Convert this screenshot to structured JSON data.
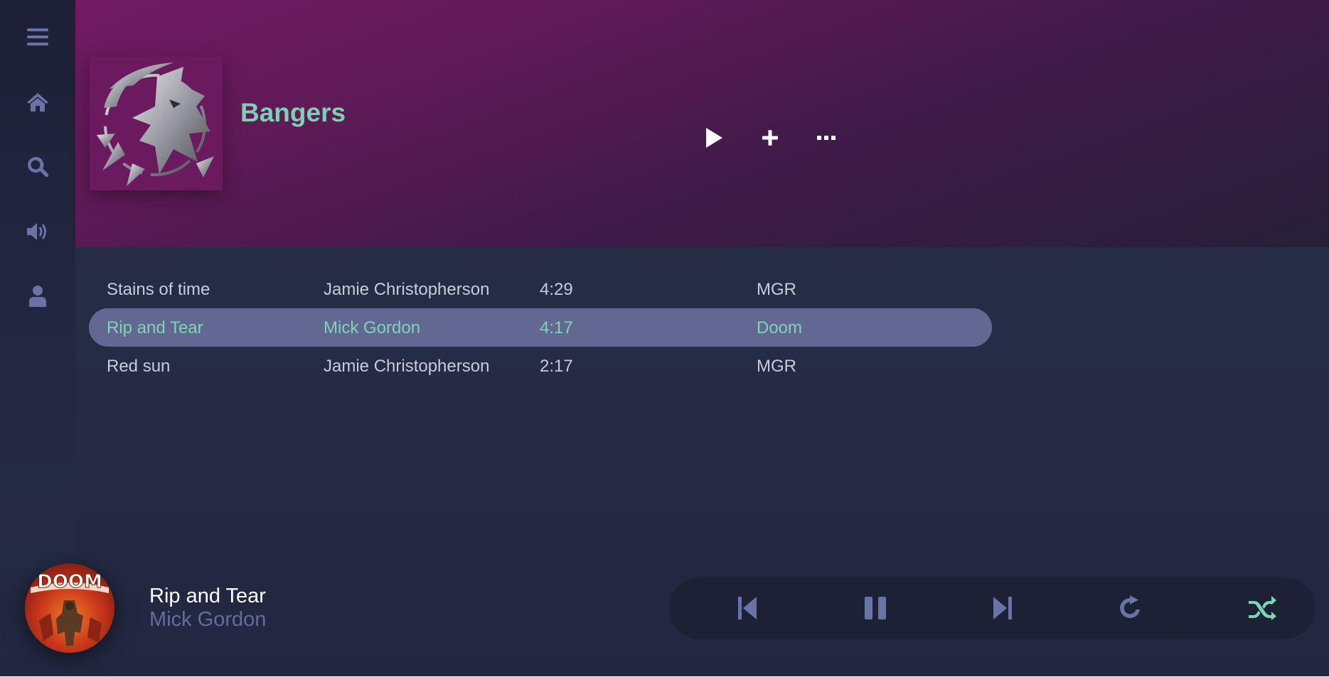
{
  "sidebar": {
    "items": [
      {
        "name": "menu",
        "icon": "hamburger-icon"
      },
      {
        "name": "home",
        "icon": "home-icon"
      },
      {
        "name": "search",
        "icon": "search-icon"
      },
      {
        "name": "volume",
        "icon": "volume-icon"
      },
      {
        "name": "profile",
        "icon": "user-icon"
      }
    ]
  },
  "header": {
    "title": "Bangers",
    "cover_icon": "wolf-medallion-art",
    "actions": [
      {
        "name": "play",
        "icon": "play-icon"
      },
      {
        "name": "add",
        "icon": "plus-icon"
      },
      {
        "name": "more",
        "icon": "ellipsis-icon"
      }
    ]
  },
  "tracks": [
    {
      "title": "Stains of time",
      "artist": "Jamie Christopherson",
      "duration": "4:29",
      "album": "MGR",
      "active": false
    },
    {
      "title": "Rip and Tear",
      "artist": "Mick Gordon",
      "duration": "4:17",
      "album": "Doom",
      "active": true
    },
    {
      "title": "Red sun",
      "artist": "Jamie Christopherson",
      "duration": "2:17",
      "album": "MGR",
      "active": false
    }
  ],
  "now_playing": {
    "title": "Rip and Tear",
    "artist": "Mick Gordon",
    "art_logo": "DOOM"
  },
  "player_controls": [
    {
      "name": "previous",
      "icon": "skip-back-icon"
    },
    {
      "name": "pause",
      "icon": "pause-icon"
    },
    {
      "name": "next",
      "icon": "skip-forward-icon"
    },
    {
      "name": "repeat",
      "icon": "repeat-icon"
    },
    {
      "name": "shuffle",
      "icon": "shuffle-icon",
      "active": true
    }
  ],
  "colors": {
    "accent": "#7fd3b6",
    "icon": "#6a73a6",
    "active_row": "#636893",
    "background": "#262f47",
    "header_top": "#721a63"
  }
}
